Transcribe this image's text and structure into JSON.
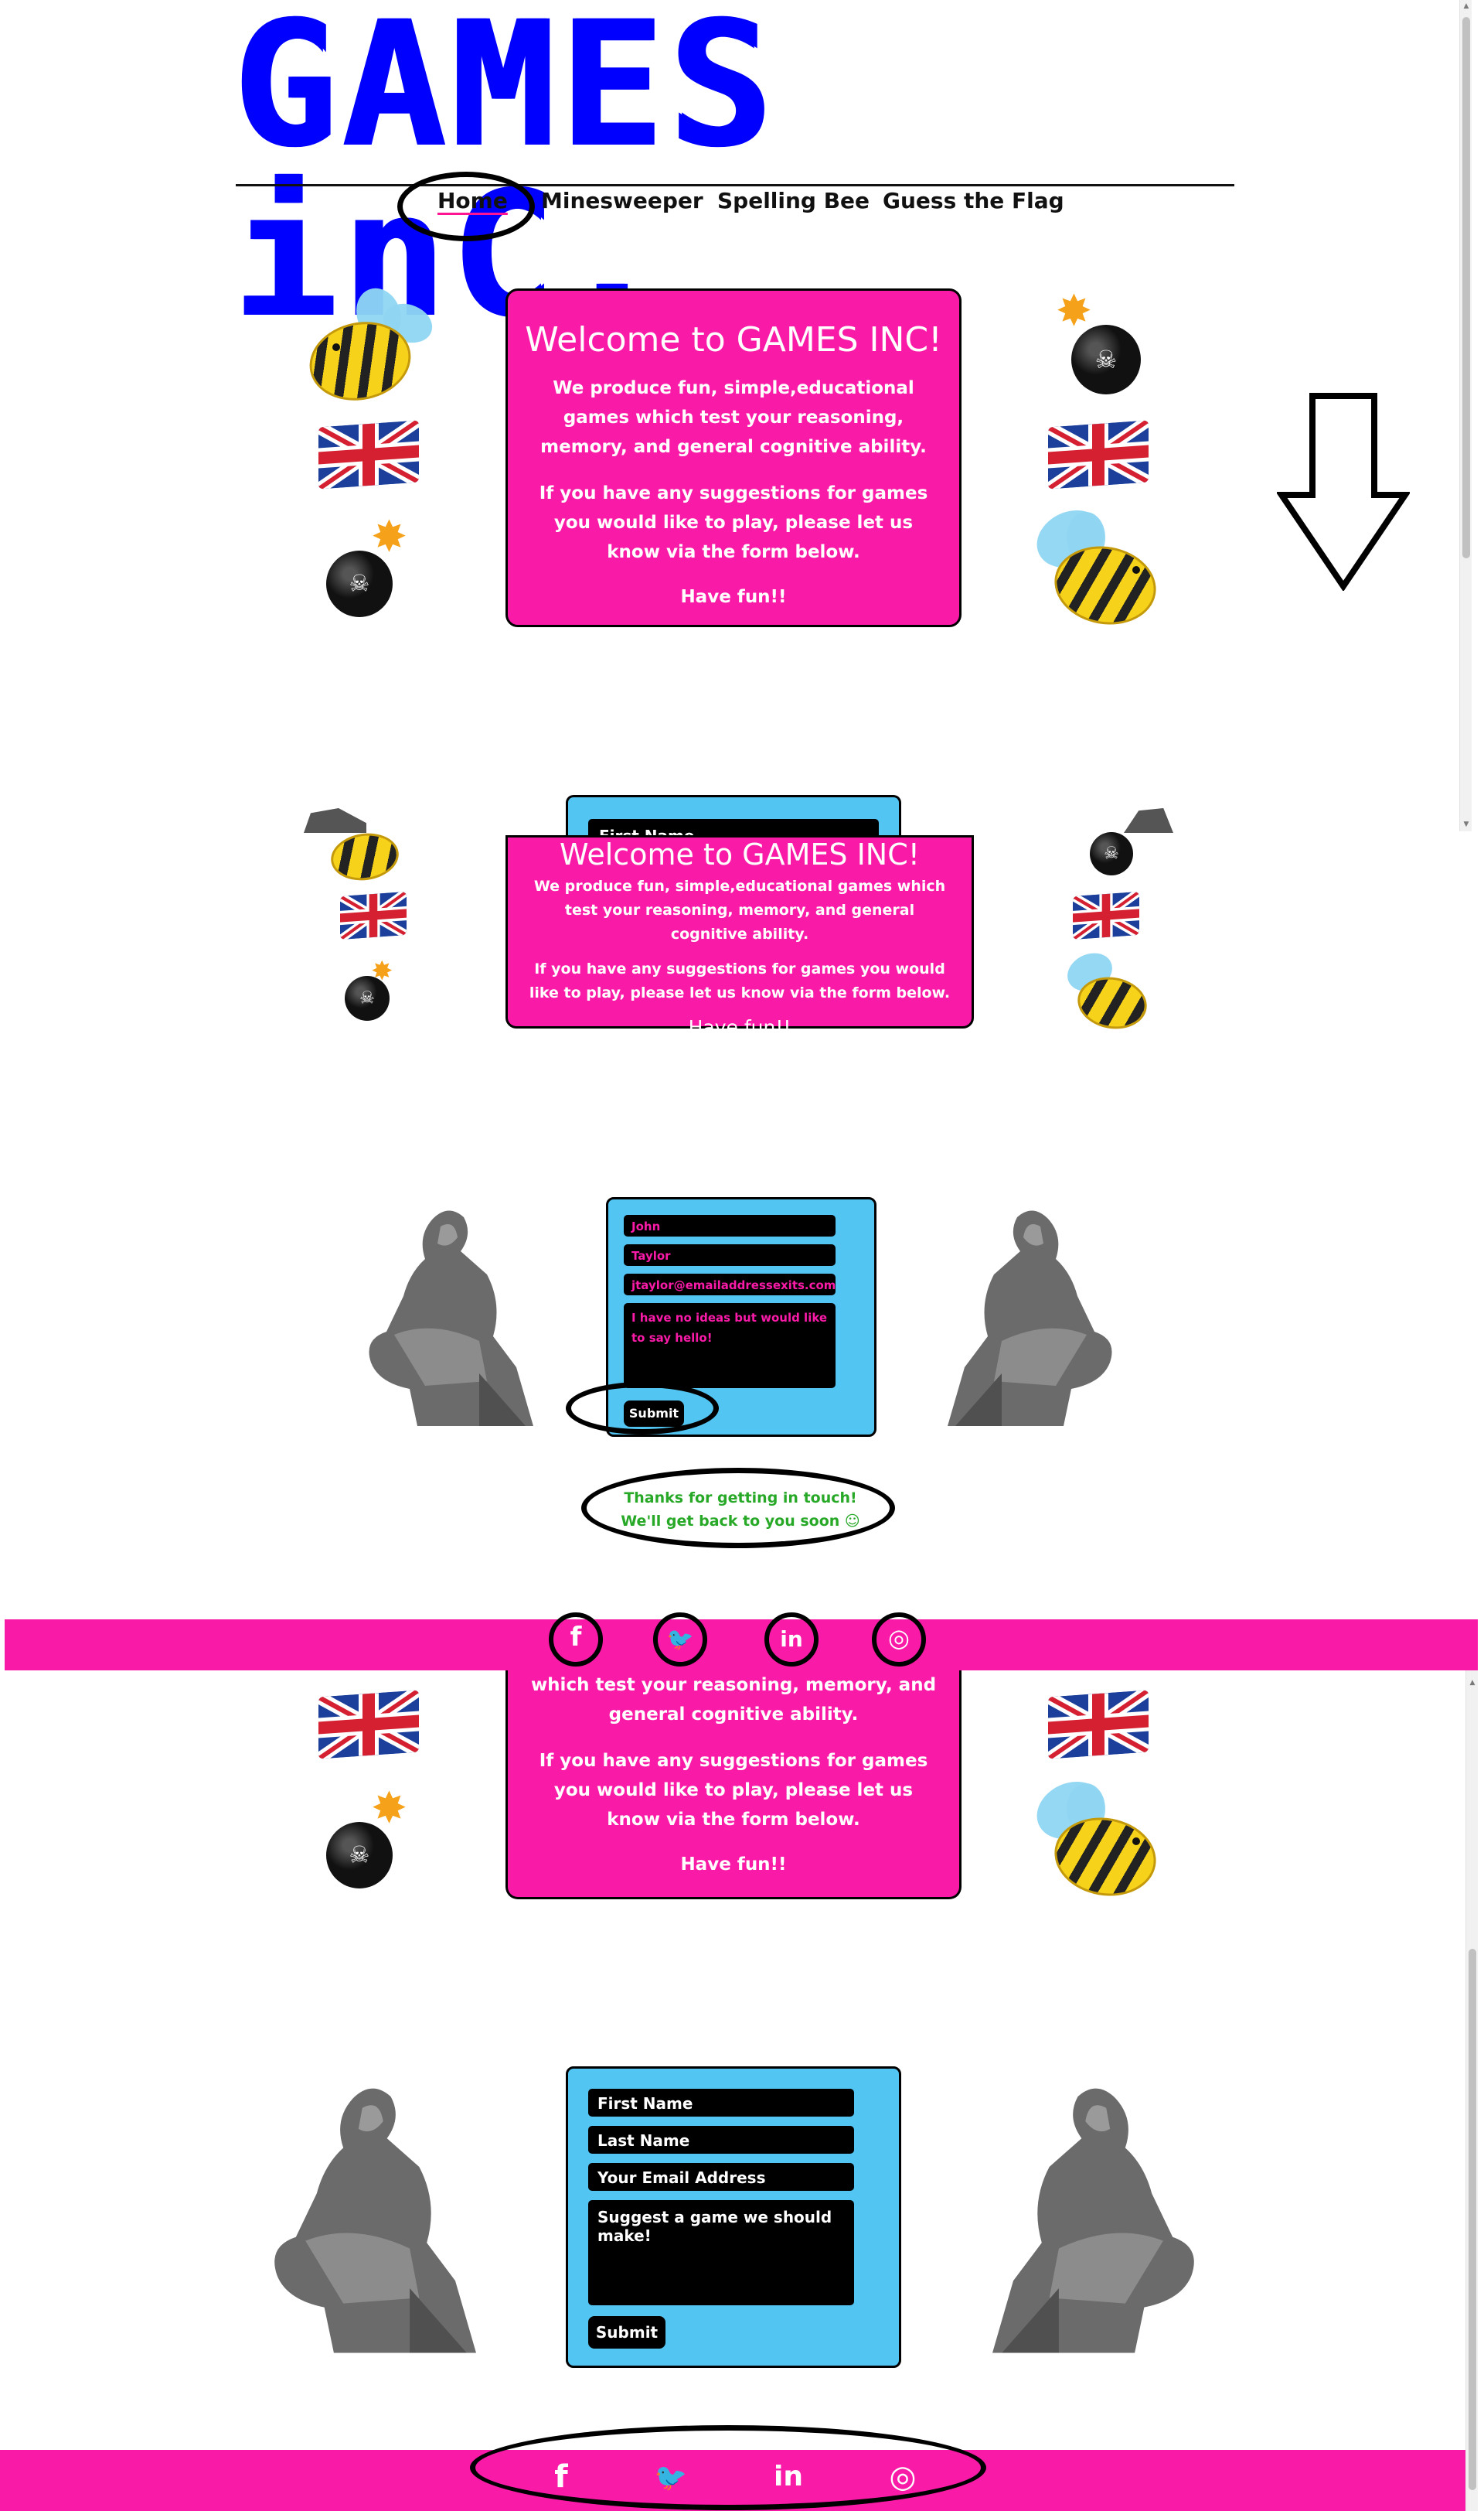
{
  "header": {
    "logo": "GAMES inC.",
    "nav": [
      "Home",
      "Minesweeper",
      "Spelling Bee",
      "Guess the Flag"
    ]
  },
  "welcome": {
    "title": "Welcome to GAMES INC!",
    "para1": "We produce fun, simple,educational games which test your reasoning, memory, and general cognitive ability.",
    "para2": "If you have any suggestions for games you would like to play, please let us know via the form below.",
    "sign": "Have fun!!",
    "para1_partial": "which test your reasoning, memory, and general cognitive ability."
  },
  "form_peek": {
    "first_name": "First Name"
  },
  "form_filled": {
    "first_name": "John",
    "last_name": "Taylor",
    "email": "jtaylor@emailaddressexits.com",
    "message": "I have no ideas but would like to say hello!",
    "submit": "Submit",
    "thanks_line1": "Thanks for getting in touch!",
    "thanks_line2": "We'll get back to you soon ☺"
  },
  "form_empty": {
    "first_name": "First Name",
    "last_name": "Last Name",
    "email": "Your Email Address",
    "message": "Suggest a game we should make!",
    "submit": "Submit"
  },
  "social": {
    "icons": [
      "facebook-icon",
      "twitter-icon",
      "linkedin-icon",
      "instagram-icon"
    ],
    "glyphs": [
      "f",
      "🐦",
      "in",
      "◎"
    ]
  },
  "colors": {
    "brand_blue": "#0000ff",
    "pink": "#f91ba7",
    "form_blue": "#52c5f2",
    "thanks_green": "#27a827"
  }
}
